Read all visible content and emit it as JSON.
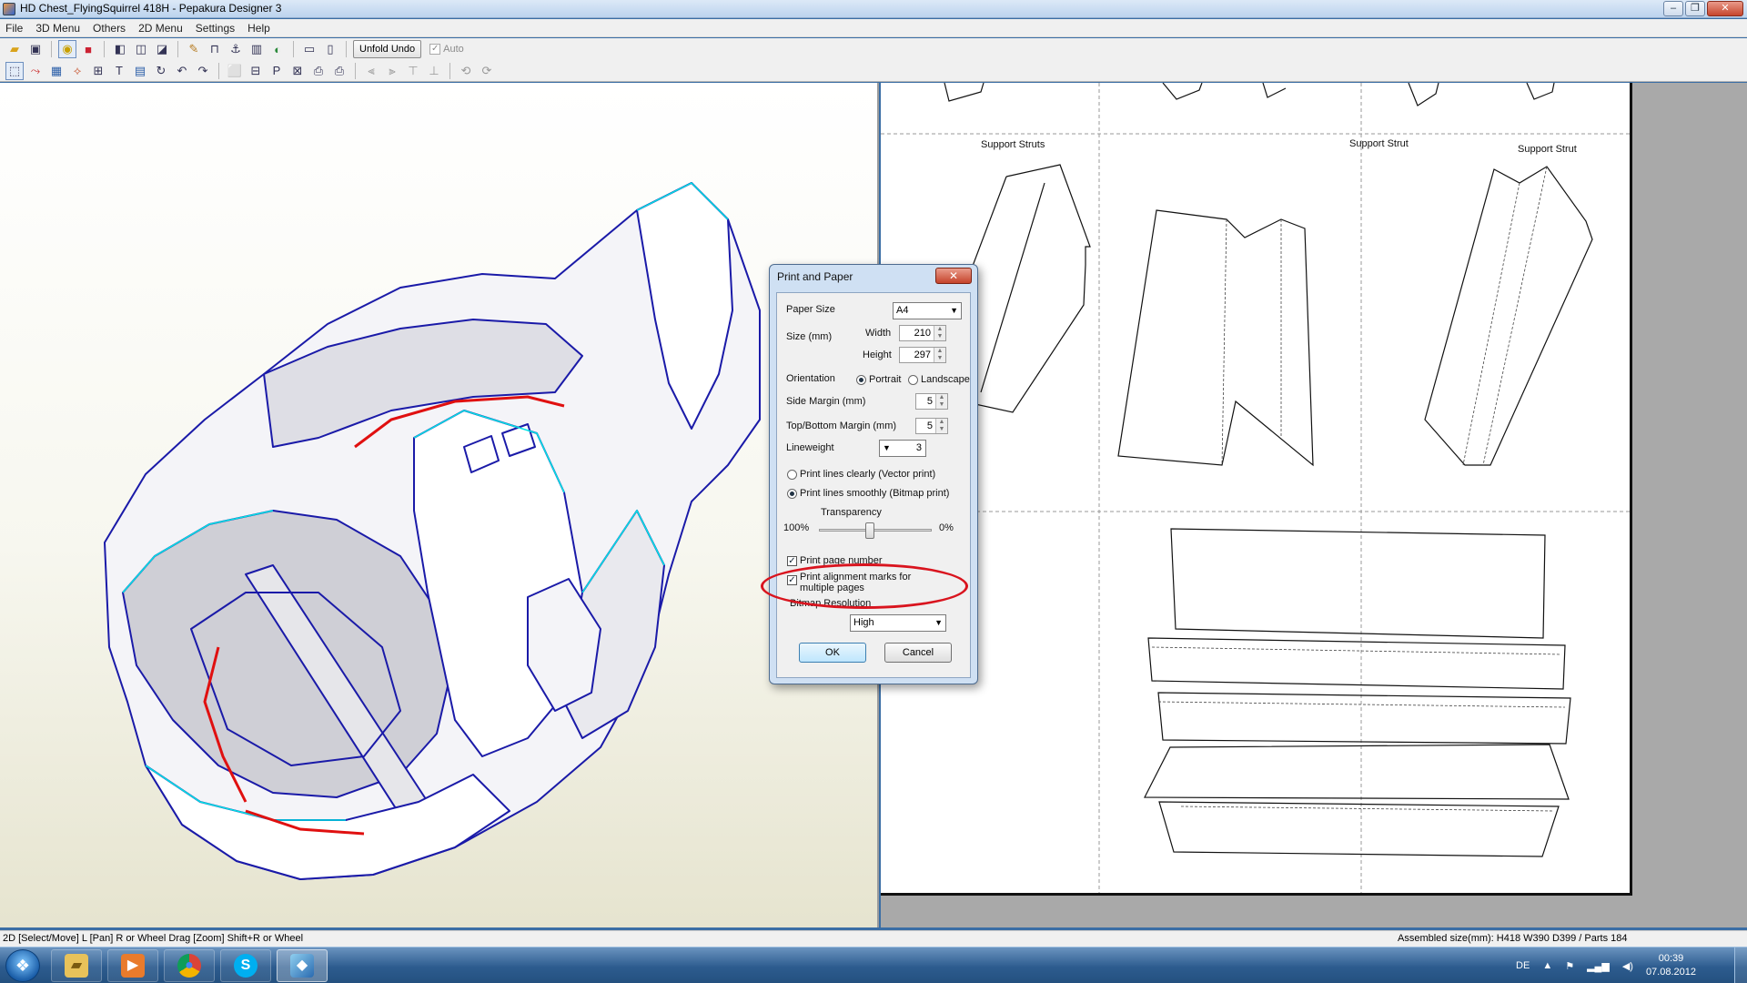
{
  "window": {
    "title": "HD Chest_FlyingSquirrel 418H - Pepakura Designer 3"
  },
  "menu": [
    "File",
    "3D Menu",
    "Others",
    "2D Menu",
    "Settings",
    "Help"
  ],
  "toolbar": {
    "unfold_undo_label": "Unfold Undo",
    "auto_label": "Auto",
    "auto_checked": true
  },
  "view2d": {
    "part_labels": [
      "Support Struts",
      "Support Strut",
      "Support Strut"
    ]
  },
  "dialog": {
    "title": "Print and Paper",
    "close_glyph": "✕",
    "paper_size_label": "Paper Size",
    "paper_size_value": "A4",
    "size_label": "Size (mm)",
    "width_label": "Width",
    "width_value": "210",
    "height_label": "Height",
    "height_value": "297",
    "orientation_label": "Orientation",
    "portrait_label": "Portrait",
    "landscape_label": "Landscape",
    "orientation_selected": "Portrait",
    "side_margin_label": "Side Margin (mm)",
    "side_margin_value": "5",
    "topbottom_margin_label": "Top/Bottom Margin (mm)",
    "topbottom_margin_value": "5",
    "lineweight_label": "Lineweight",
    "lineweight_value": "3",
    "vector_print_label": "Print lines clearly (Vector print)",
    "bitmap_print_label": "Print lines smoothly (Bitmap print)",
    "print_mode_selected": "bitmap",
    "transparency_label": "Transparency",
    "transparency_min_label": "100%",
    "transparency_max_label": "0%",
    "transparency_fraction": 0.45,
    "page_number_label": "Print page number",
    "page_number_checked": true,
    "alignment_marks_label": "Print alignment marks for multiple pages",
    "alignment_marks_checked": true,
    "bitmap_resolution_label": "Bitmap Resolution",
    "bitmap_resolution_value": "High",
    "ok_label": "OK",
    "cancel_label": "Cancel"
  },
  "status": {
    "left": "2D [Select/Move] L [Pan] R or Wheel Drag [Zoom] Shift+R or Wheel",
    "right": "Assembled size(mm): H418 W390 D399 / Parts 184"
  },
  "taskbar": {
    "language": "DE",
    "time": "00:39",
    "date": "07.08.2012"
  },
  "colors": {
    "mesh_edge": "#1a1aa8",
    "mesh_highlight": "#00e5e5",
    "cut_line": "#e01010",
    "annotation": "#d9141e"
  }
}
